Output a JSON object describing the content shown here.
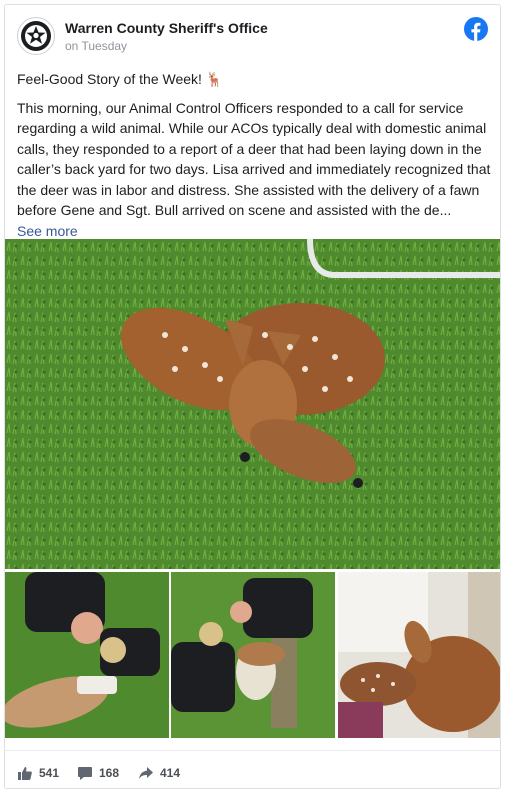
{
  "post": {
    "page_name": "Warren County Sheriff's Office",
    "timestamp": "on Tuesday",
    "headline": "Feel-Good Story of the Week! 🦌",
    "body": "This morning, our Animal Control Officers responded to a call for service regarding a wild animal. While our ACOs typically deal with domestic animal calls, they responded to a report of a deer that had been laying down in the caller’s back yard for two days. Lisa arrived and immediately recognized that the deer was in labor and distress. She assisted with the delivery of a fawn before Gene and Sgt. Bull arrived on scene and assisted with the de...",
    "see_more": "See more"
  },
  "stats": {
    "likes": "541",
    "comments": "168",
    "shares": "414"
  },
  "colors": {
    "facebook_blue": "#1877f2",
    "link": "#385898",
    "grass": "#4f8a2e"
  },
  "icons": [
    "sheriff-star-icon",
    "facebook-logo-icon",
    "like-icon",
    "comment-icon",
    "share-icon"
  ]
}
